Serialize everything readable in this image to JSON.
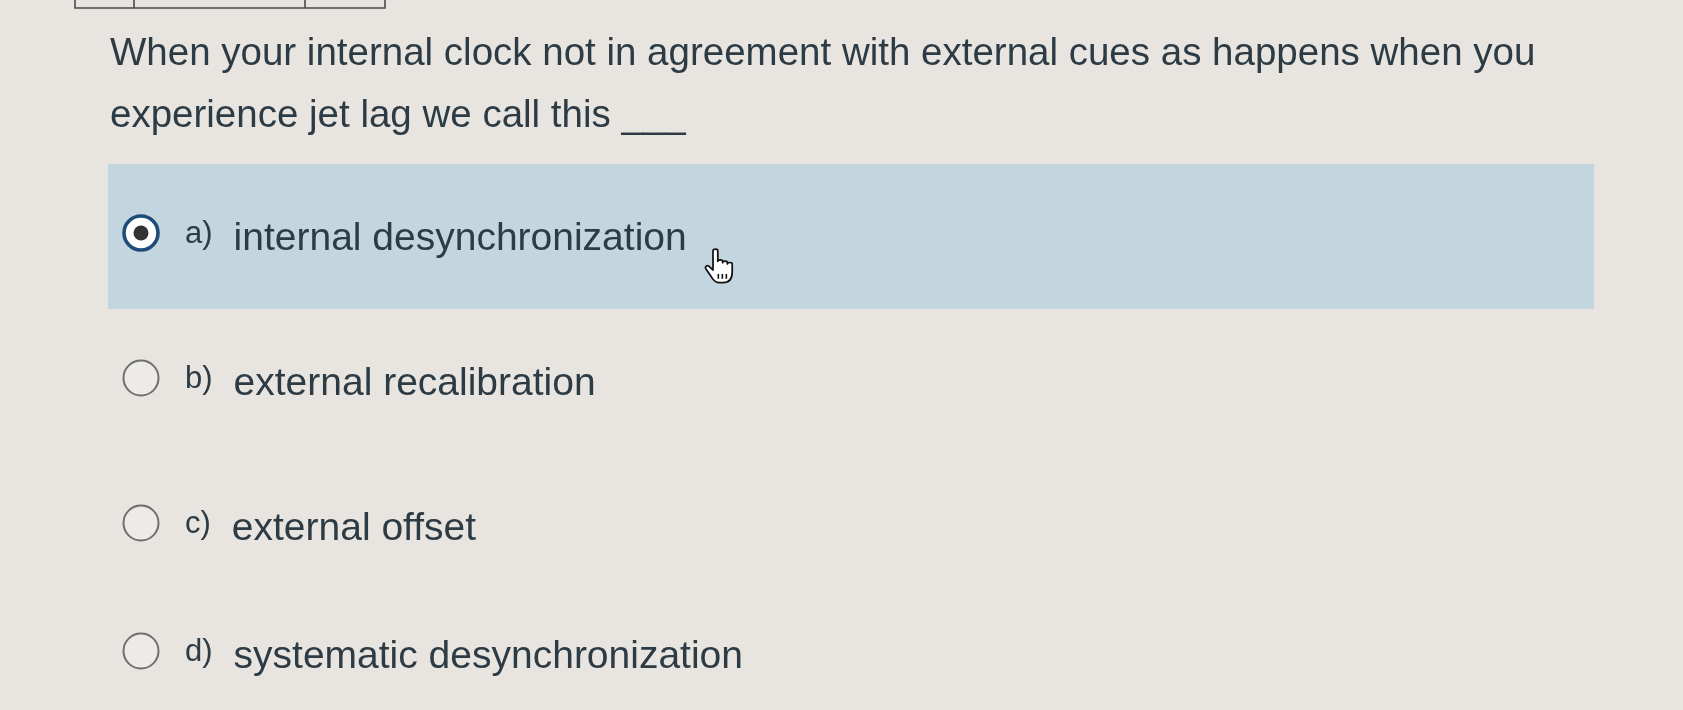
{
  "question": {
    "text": "When your internal clock not in agreement with external cues as happens when you experience jet lag we call this ___"
  },
  "options": [
    {
      "letter": "a)",
      "text": "internal desynchronization",
      "selected": true
    },
    {
      "letter": "b)",
      "text": "external recalibration",
      "selected": false
    },
    {
      "letter": "c)",
      "text": "external offset",
      "selected": false
    },
    {
      "letter": "d)",
      "text": "systematic desynchronization",
      "selected": false
    }
  ]
}
